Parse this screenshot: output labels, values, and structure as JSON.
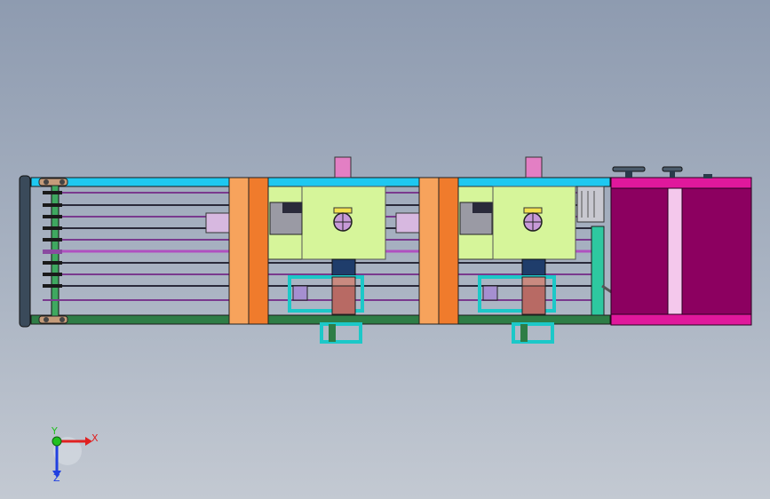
{
  "view": {
    "background_top": "#8e9bb0",
    "background_bottom": "#c3c9d2"
  },
  "colors": {
    "cyan_rail": "#1ec8f0",
    "green_rail": "#2e7d46",
    "orange_light": "#f7a35c",
    "orange_dark": "#f07b2c",
    "lime_panel": "#d6f59a",
    "magenta_box": "#8c0060",
    "magenta_frame": "#e0189c",
    "pink_tab": "#e37fc4",
    "purple_line": "#7a3a8e",
    "teal": "#1cc8c8",
    "navy_block": "#1f3d6b",
    "brown_block": "#b86a64",
    "lavender": "#a58fd0",
    "frame_dark": "#2a3a4a"
  },
  "triad": {
    "x_label": "X",
    "y_label": "Y",
    "z_label": "Z",
    "x_color": "#e02020",
    "y_color": "#20c020",
    "z_color": "#2040e0"
  }
}
